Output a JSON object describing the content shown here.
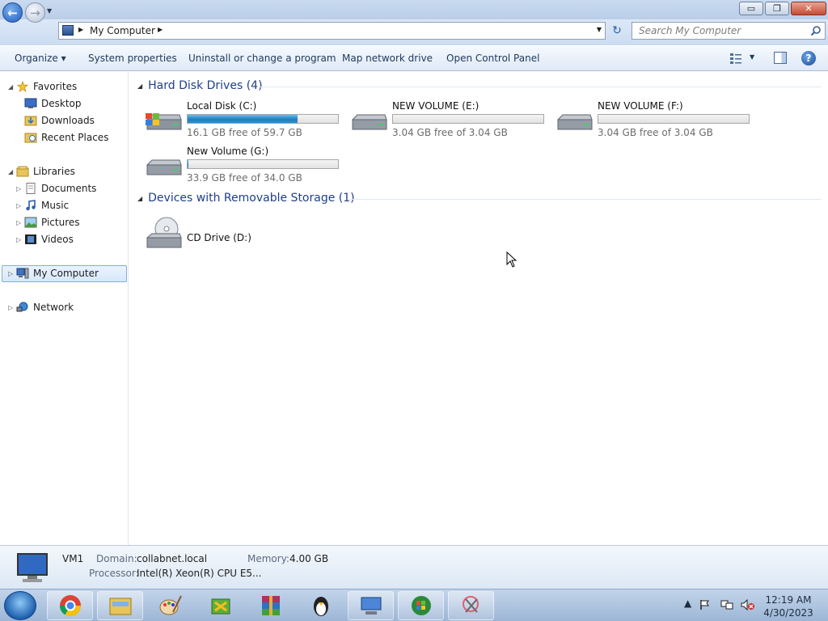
{
  "window": {
    "controls": {
      "minimize": "▭",
      "maximize": "❐",
      "close": "✕"
    }
  },
  "address": {
    "path_label": "My Computer",
    "search_placeholder": "Search My Computer"
  },
  "toolbar": {
    "organize": "Organize ▾",
    "system_properties": "System properties",
    "uninstall": "Uninstall or change a program",
    "map_drive": "Map network drive",
    "control_panel": "Open Control Panel",
    "help": "?"
  },
  "navpane": {
    "favorites": "Favorites",
    "desktop": "Desktop",
    "downloads": "Downloads",
    "recent": "Recent Places",
    "libraries": "Libraries",
    "documents": "Documents",
    "music": "Music",
    "pictures": "Pictures",
    "videos": "Videos",
    "my_computer": "My Computer",
    "network": "Network"
  },
  "groups": {
    "hdd": {
      "title": "Hard Disk Drives (4)",
      "drives": [
        {
          "name": "Local Disk (C:)",
          "free": "16.1 GB free of 59.7 GB",
          "used_fraction": 0.73,
          "system": true
        },
        {
          "name": "NEW VOLUME (E:)",
          "free": "3.04 GB free of 3.04 GB",
          "used_fraction": 0
        },
        {
          "name": "NEW VOLUME (F:)",
          "free": "3.04 GB free of 3.04 GB",
          "used_fraction": 0
        },
        {
          "name": "New Volume (G:)",
          "free": "33.9 GB free of 34.0 GB",
          "used_fraction": 0.003
        }
      ]
    },
    "removable": {
      "title": "Devices with Removable Storage (1)",
      "drives": [
        {
          "name": "CD Drive (D:)"
        }
      ]
    }
  },
  "details": {
    "computer_name": "VM1",
    "domain_label": "Domain:",
    "domain_value": "collabnet.local",
    "memory_label": "Memory:",
    "memory_value": "4.00 GB",
    "processor_label": "Processor:",
    "processor_value": "Intel(R) Xeon(R) CPU E5..."
  },
  "taskbar": {
    "time": "12:19 AM",
    "date": "4/30/2023",
    "apps": [
      "chrome-icon",
      "explorer-folder-icon",
      "paint-icon",
      "app-icon-green",
      "winrar-icon",
      "linux-penguin-icon",
      "remote-desktop-icon",
      "windows-orb-icon",
      "snipping-tool-icon"
    ]
  },
  "colors": {
    "accent": "#1e3f8a",
    "drive_fill": "#2a90cc"
  }
}
